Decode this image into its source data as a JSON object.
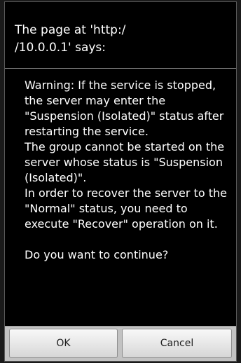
{
  "dialog": {
    "title": "The page at 'http:/\n/10.0.0.1' says:",
    "message": "Warning: If the service is stopped, the server may enter the \"Suspension (Isolated)\" status after restarting the service.\nThe group cannot be started on the server whose status is \"Suspension (Isolated)\".\nIn order to recover the server to the \"Normal\" status, you need to execute \"Recover\" operation on it.\n\nDo you want to continue?",
    "ok_label": "OK",
    "cancel_label": "Cancel"
  },
  "colors": {
    "dialog_background": "#000000",
    "button_bar_background": "#c2c2c2",
    "text": "#ffffff"
  }
}
